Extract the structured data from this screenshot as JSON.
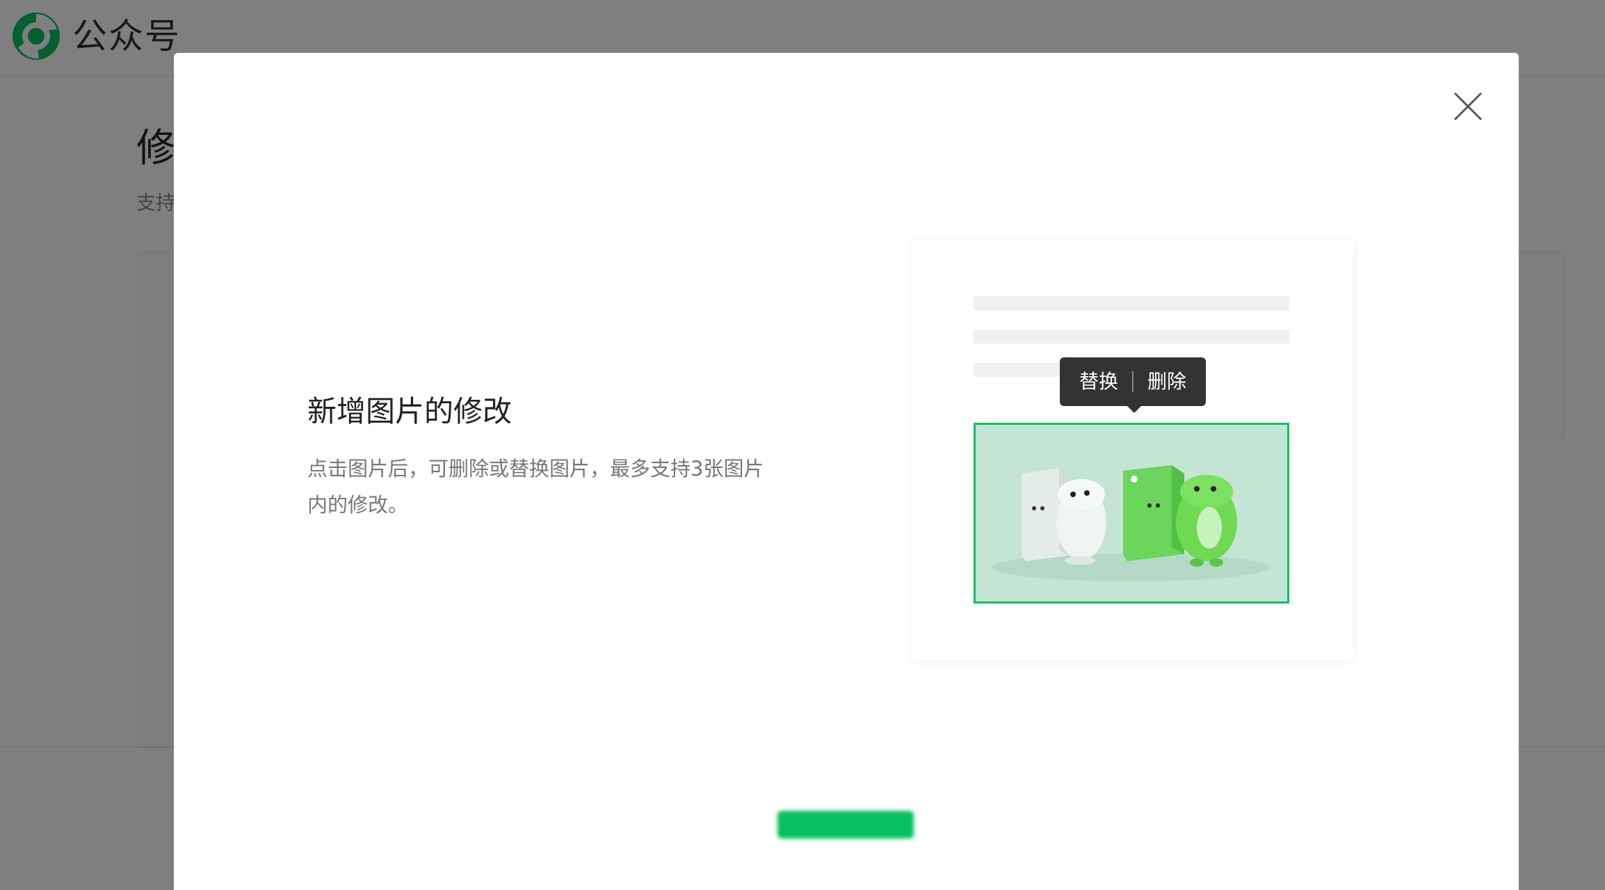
{
  "background": {
    "brand": "公众号",
    "page_title": "修",
    "page_subtitle": "支持"
  },
  "dialog": {
    "intro_title": "新增图片的修改",
    "intro_desc": "点击图片后，可删除或替换图片，最多支持3张图片内的修改。",
    "tooltip": {
      "replace_label": "替换",
      "delete_label": "删除"
    },
    "primary_button_label": ""
  },
  "colors": {
    "accent": "#07c160",
    "mask": "rgba(0,0,0,0.5)",
    "tooltip_bg": "#333333"
  },
  "icons": {
    "logo": "wechat-official-account-logo-icon",
    "close": "close-icon"
  }
}
